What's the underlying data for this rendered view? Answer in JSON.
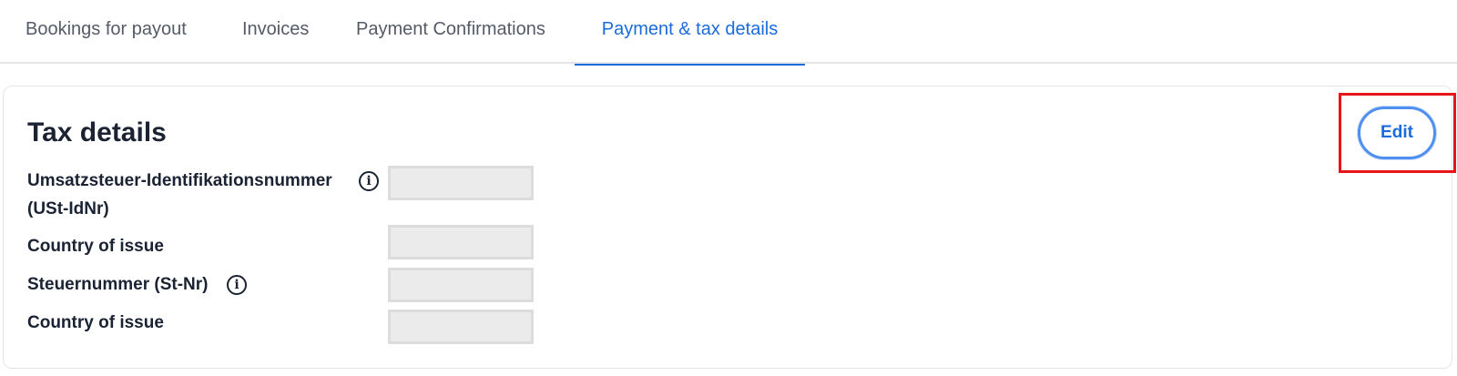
{
  "tabs": [
    {
      "label": "Bookings for payout",
      "active": false
    },
    {
      "label": "Invoices",
      "active": false
    },
    {
      "label": "Payment Confirmations",
      "active": false
    },
    {
      "label": "Payment & tax details",
      "active": true
    }
  ],
  "colors": {
    "accent": "#1a6bdc",
    "heading": "#1b2333",
    "tab_inactive": "#545b66",
    "highlight": "#e8141a",
    "value_box": "#ebebeb"
  },
  "tax_details": {
    "title": "Tax details",
    "edit_label": "Edit",
    "fields": [
      {
        "label_line1": "Umsatzsteuer-Identifikationsnummer",
        "label_line2": "(USt-IdNr)",
        "info_icon": "info-icon",
        "value": ""
      },
      {
        "label": "Country of issue",
        "value": ""
      },
      {
        "label": "Steuernummer (St-Nr)",
        "info_icon": "info-icon",
        "value": ""
      },
      {
        "label": "Country of issue",
        "value": ""
      }
    ]
  }
}
